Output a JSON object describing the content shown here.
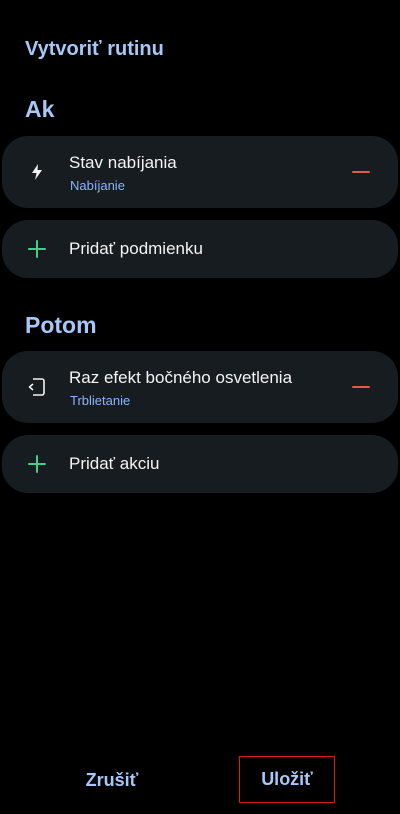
{
  "header": {
    "title": "Vytvoriť rutinu"
  },
  "if_section": {
    "title": "Ak",
    "condition": {
      "title": "Stav nabíjania",
      "subtitle": "Nabíjanie",
      "icon": "lightning-bolt-icon"
    },
    "add_label": "Pridať podmienku"
  },
  "then_section": {
    "title": "Potom",
    "action": {
      "title": "Raz efekt bočného osvetlenia",
      "subtitle": "Trblietanie",
      "icon": "edge-lighting-icon"
    },
    "add_label": "Pridať akciu"
  },
  "footer": {
    "cancel_label": "Zrušiť",
    "save_label": "Uložiť"
  },
  "colors": {
    "background": "#000000",
    "card": "#171c21",
    "accent": "#a7c8f6",
    "subtitle": "#8ab4f8",
    "add_icon": "#3fcf8e",
    "remove_icon": "#e2584a",
    "highlight_box": "#e0161b"
  }
}
